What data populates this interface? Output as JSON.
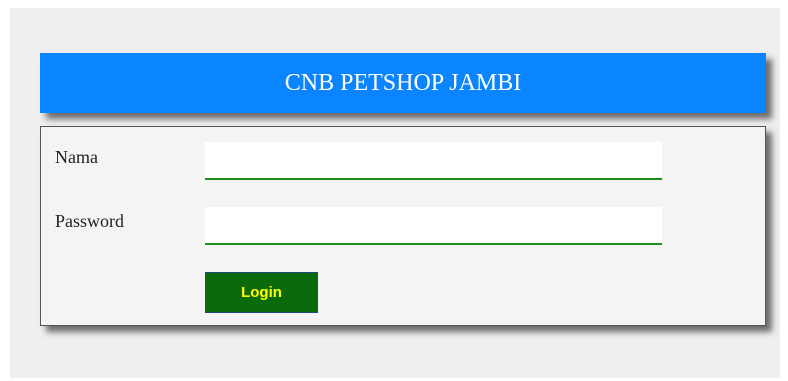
{
  "header": {
    "title": "CNB PETSHOP JAMBI"
  },
  "form": {
    "nama_label": "Nama",
    "nama_value": "",
    "password_label": "Password",
    "password_value": "",
    "login_label": "Login"
  },
  "colors": {
    "header_bg": "#0a84ff",
    "input_underline": "#1e8c1e",
    "button_bg": "#0b6b0b",
    "button_text": "#ffff00"
  }
}
